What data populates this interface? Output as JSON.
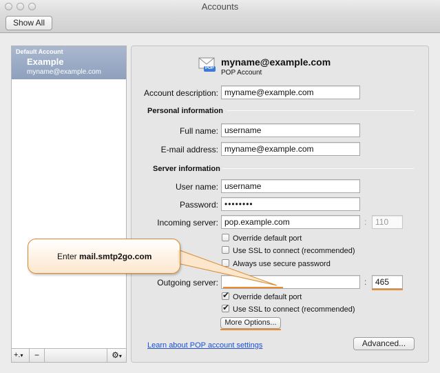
{
  "window": {
    "title": "Accounts"
  },
  "toolbar": {
    "show_all_label": "Show All"
  },
  "sidebar": {
    "account": {
      "group_label": "Default Account",
      "name": "Example",
      "email": "myname@example.com"
    },
    "add_label": "+.",
    "add_menu_glyph": "▾",
    "remove_label": "−",
    "gear_menu_glyph": "▾"
  },
  "header": {
    "email": "myname@example.com",
    "type": "POP Account",
    "icon_badge": "POP"
  },
  "form": {
    "account_description": {
      "label": "Account description:",
      "value": "myname@example.com"
    },
    "personal_section": "Personal information",
    "full_name": {
      "label": "Full name:",
      "value": "username"
    },
    "email_address": {
      "label": "E-mail address:",
      "value": "myname@example.com"
    },
    "server_section": "Server information",
    "user_name": {
      "label": "User name:",
      "value": "username"
    },
    "password": {
      "label": "Password:",
      "value": "••••••••"
    },
    "incoming_server": {
      "label": "Incoming server:",
      "value": "pop.example.com",
      "port_sep": ":",
      "port": "110"
    },
    "incoming_options": [
      {
        "label": "Override default port",
        "checked": false
      },
      {
        "label": "Use SSL to connect (recommended)",
        "checked": false
      },
      {
        "label": "Always use secure password",
        "checked": false
      }
    ],
    "outgoing_server": {
      "label": "Outgoing server:",
      "value": "",
      "port_sep": ":",
      "port": "465"
    },
    "outgoing_options": [
      {
        "label": "Override default port",
        "checked": true
      },
      {
        "label": "Use SSL to connect (recommended)",
        "checked": true
      }
    ],
    "more_options_label": "More Options...",
    "learn_link": "Learn about POP account settings",
    "advanced_label": "Advanced..."
  },
  "callout": {
    "prefix": "Enter ",
    "highlight": "mail.smtp2go.com"
  },
  "colors": {
    "highlight_orange": "#f08a2c",
    "selection_blue": "#8ea0bd",
    "link_blue": "#1a4fd6"
  }
}
